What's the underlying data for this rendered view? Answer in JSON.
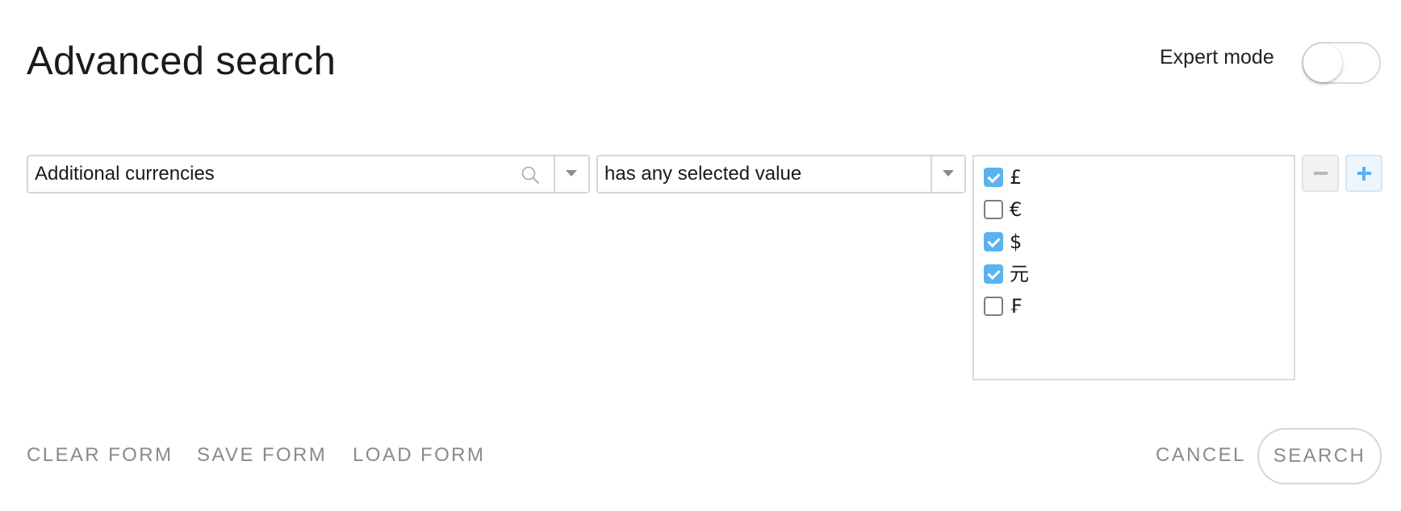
{
  "header": {
    "title": "Advanced search",
    "expert_mode_label": "Expert mode",
    "expert_mode_on": false
  },
  "criteria": {
    "field": {
      "value": "Additional currencies",
      "search_icon": "search-icon",
      "dropdown_icon": "chevron-down-icon"
    },
    "operator": {
      "value": "has any selected value",
      "dropdown_icon": "chevron-down-icon"
    },
    "values": [
      {
        "label": "£",
        "checked": true
      },
      {
        "label": "€",
        "checked": false
      },
      {
        "label": "$",
        "checked": true
      },
      {
        "label": "元",
        "checked": true
      },
      {
        "label": "₣",
        "checked": false
      }
    ],
    "remove_icon": "minus-icon",
    "add_icon": "plus-icon"
  },
  "footer": {
    "clear_label": "CLEAR FORM",
    "save_label": "SAVE FORM",
    "load_label": "LOAD FORM",
    "cancel_label": "CANCEL",
    "search_label": "SEARCH"
  },
  "colors": {
    "accent": "#5ab3ee",
    "muted_text": "#8a8a8a",
    "border": "#d6d6d6"
  }
}
